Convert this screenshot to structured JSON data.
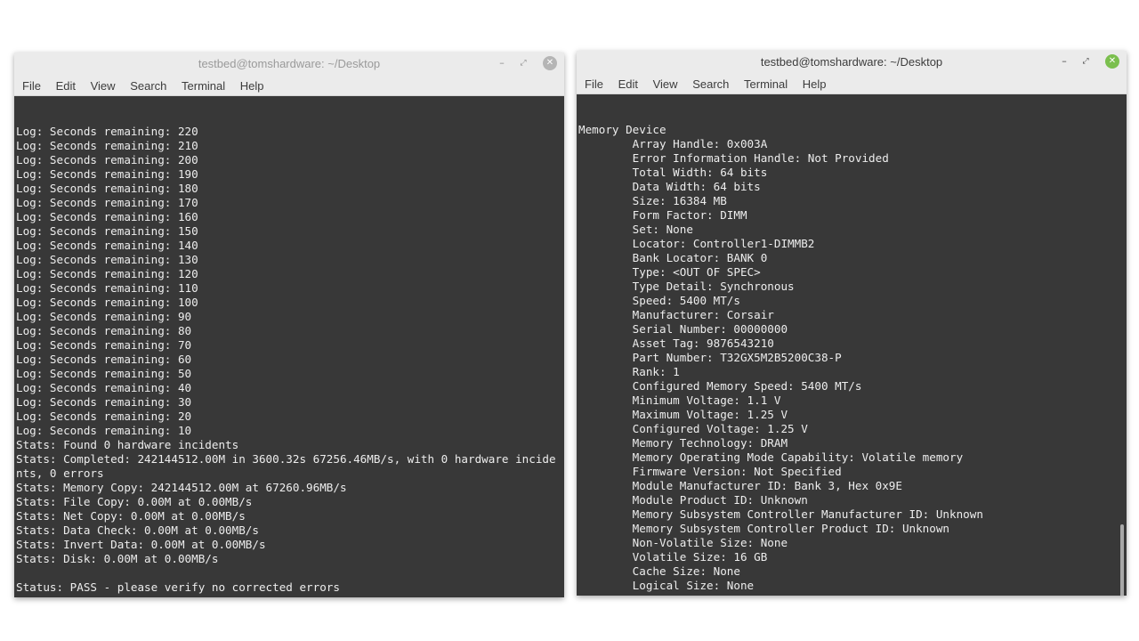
{
  "left": {
    "title": "testbed@tomshardware: ~/Desktop",
    "menu": [
      "File",
      "Edit",
      "View",
      "Search",
      "Terminal",
      "Help"
    ],
    "lines": [
      "Log: Seconds remaining: 220",
      "Log: Seconds remaining: 210",
      "Log: Seconds remaining: 200",
      "Log: Seconds remaining: 190",
      "Log: Seconds remaining: 180",
      "Log: Seconds remaining: 170",
      "Log: Seconds remaining: 160",
      "Log: Seconds remaining: 150",
      "Log: Seconds remaining: 140",
      "Log: Seconds remaining: 130",
      "Log: Seconds remaining: 120",
      "Log: Seconds remaining: 110",
      "Log: Seconds remaining: 100",
      "Log: Seconds remaining: 90",
      "Log: Seconds remaining: 80",
      "Log: Seconds remaining: 70",
      "Log: Seconds remaining: 60",
      "Log: Seconds remaining: 50",
      "Log: Seconds remaining: 40",
      "Log: Seconds remaining: 30",
      "Log: Seconds remaining: 20",
      "Log: Seconds remaining: 10",
      "Stats: Found 0 hardware incidents",
      "Stats: Completed: 242144512.00M in 3600.32s 67256.46MB/s, with 0 hardware incide",
      "nts, 0 errors",
      "Stats: Memory Copy: 242144512.00M at 67260.96MB/s",
      "Stats: File Copy: 0.00M at 0.00MB/s",
      "Stats: Net Copy: 0.00M at 0.00MB/s",
      "Stats: Data Check: 0.00M at 0.00MB/s",
      "Stats: Invert Data: 0.00M at 0.00MB/s",
      "Stats: Disk: 0.00M at 0.00MB/s",
      "",
      "Status: PASS - please verify no corrected errors",
      ""
    ],
    "prompt_user": "testbed@tomshardware",
    "prompt_sep": ":",
    "prompt_path": "~/Desktop",
    "prompt_end": "$"
  },
  "right": {
    "title": "testbed@tomshardware: ~/Desktop",
    "menu": [
      "File",
      "Edit",
      "View",
      "Search",
      "Terminal",
      "Help"
    ],
    "lines": [
      "Memory Device",
      "        Array Handle: 0x003A",
      "        Error Information Handle: Not Provided",
      "        Total Width: 64 bits",
      "        Data Width: 64 bits",
      "        Size: 16384 MB",
      "        Form Factor: DIMM",
      "        Set: None",
      "        Locator: Controller1-DIMMB2",
      "        Bank Locator: BANK 0",
      "        Type: <OUT OF SPEC>",
      "        Type Detail: Synchronous",
      "        Speed: 5400 MT/s",
      "        Manufacturer: Corsair",
      "        Serial Number: 00000000",
      "        Asset Tag: 9876543210",
      "        Part Number: T32GX5M2B5200C38-P",
      "        Rank: 1",
      "        Configured Memory Speed: 5400 MT/s",
      "        Minimum Voltage: 1.1 V",
      "        Maximum Voltage: 1.25 V",
      "        Configured Voltage: 1.25 V",
      "        Memory Technology: DRAM",
      "        Memory Operating Mode Capability: Volatile memory",
      "        Firmware Version: Not Specified",
      "        Module Manufacturer ID: Bank 3, Hex 0x9E",
      "        Module Product ID: Unknown",
      "        Memory Subsystem Controller Manufacturer ID: Unknown",
      "        Memory Subsystem Controller Product ID: Unknown",
      "        Non-Volatile Size: None",
      "        Volatile Size: 16 GB",
      "        Cache Size: None",
      "        Logical Size: None",
      ""
    ],
    "prompt_user": "testbed@tomshardware",
    "prompt_sep": ":",
    "prompt_path": "~/Desktop",
    "prompt_end": "$"
  },
  "icons": {
    "minimize": "minimize-icon",
    "maximize": "maximize-icon",
    "close": "close-icon"
  }
}
